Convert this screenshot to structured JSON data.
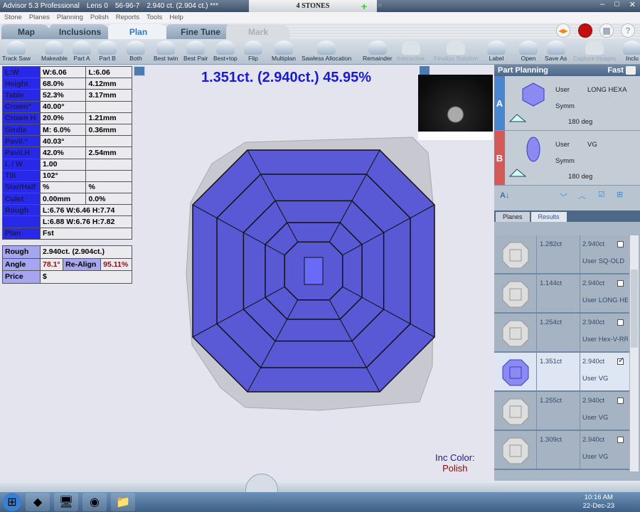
{
  "window": {
    "title": "Advisor 5.3 Professional",
    "lens": "Lens 0",
    "stone_id": "56-96-7",
    "weight": "2.940 ct. (2.904 ct.) ***",
    "tab_title": "4 STONES"
  },
  "menu": [
    "Stone",
    "Planes",
    "Planning",
    "Polish",
    "Reports",
    "Tools",
    "Help"
  ],
  "tabs": [
    {
      "label": "Map"
    },
    {
      "label": "Inclusions"
    },
    {
      "label": "Plan"
    },
    {
      "label": "Fine Tune"
    },
    {
      "label": "Mark"
    }
  ],
  "toolbar": [
    "Track Saw",
    "Makeable",
    "Part A",
    "Part B",
    "Both",
    "Best twin",
    "Best Pair",
    "Best+top",
    "Flip",
    "Multiplan",
    "Sawless Allocation",
    "Remainder",
    "Interactive",
    "Finalize Solution",
    "Label",
    "Open",
    "Save As",
    "Capture Images",
    "Inclu"
  ],
  "spec": [
    [
      "L:W",
      "W:6.06",
      "L:6.06"
    ],
    [
      "Height",
      "68.0%",
      "4.12mm"
    ],
    [
      "Table",
      "52.3%",
      "3.17mm"
    ],
    [
      "Crown°",
      "40.00°",
      ""
    ],
    [
      "Crown H",
      "20.0%",
      "1.21mm"
    ],
    [
      "Girdle",
      "M: 6.0%",
      "0.36mm"
    ],
    [
      "Pavil.°",
      "40.03°",
      ""
    ],
    [
      "Pavil.H",
      "42.0%",
      "2.54mm"
    ],
    [
      "L / W",
      "1.00",
      ""
    ],
    [
      "Tilt",
      "102°",
      ""
    ],
    [
      "Star/Half",
      "%",
      "%"
    ],
    [
      "Culet",
      "0.00mm",
      "0.0%"
    ],
    [
      "Rough",
      "L:6.76 W:6.46 H:7.74"
    ],
    [
      "",
      "L:6.88 W:6.76 H:7.82"
    ],
    [
      "Plan",
      "Fst"
    ]
  ],
  "summary": {
    "rough_label": "Rough",
    "rough": "2.940ct. (2.904ct.)",
    "angle_label": "Angle",
    "angle": "78.1°",
    "realign_label": "Re-Align",
    "realign": "95.11%",
    "price_label": "Price",
    "price": "$"
  },
  "headline": "1.351ct. (2.940ct.) 45.95%",
  "inc_color": {
    "label": "Inc Color:",
    "value": "Polish"
  },
  "stone_color": "#5a5ad6",
  "part_planning": {
    "title": "Part Planning",
    "mode": "Fast",
    "parts": [
      {
        "label": "A",
        "user": "User",
        "shape": "LONG HEXA",
        "symm": "Symm",
        "angle": "180 deg",
        "color": "#4a86d0"
      },
      {
        "label": "B",
        "user": "User",
        "shape": "VG",
        "symm": "Symm",
        "angle": "180 deg",
        "color": "#d45a5a"
      }
    ],
    "tabs": [
      "Planes",
      "Results"
    ],
    "results": [
      {
        "weight": "1.282ct",
        "rough": "2.940ct",
        "name": "User SQ-OLD",
        "checked": false
      },
      {
        "weight": "1.144ct",
        "rough": "2.940ct",
        "name": "User LONG HEXA",
        "checked": false
      },
      {
        "weight": "1.254ct",
        "rough": "2.940ct",
        "name": "User Hex-V-RR",
        "checked": false
      },
      {
        "weight": "1.351ct",
        "rough": "2.940ct",
        "name": "User VG",
        "checked": true
      },
      {
        "weight": "1.255ct",
        "rough": "2.940ct",
        "name": "User VG",
        "checked": false
      },
      {
        "weight": "1.309ct",
        "rough": "2.940ct",
        "name": "User VG",
        "checked": false
      }
    ]
  },
  "taskbar": {
    "time": "10:16 AM",
    "date": "22-Dec-23"
  }
}
